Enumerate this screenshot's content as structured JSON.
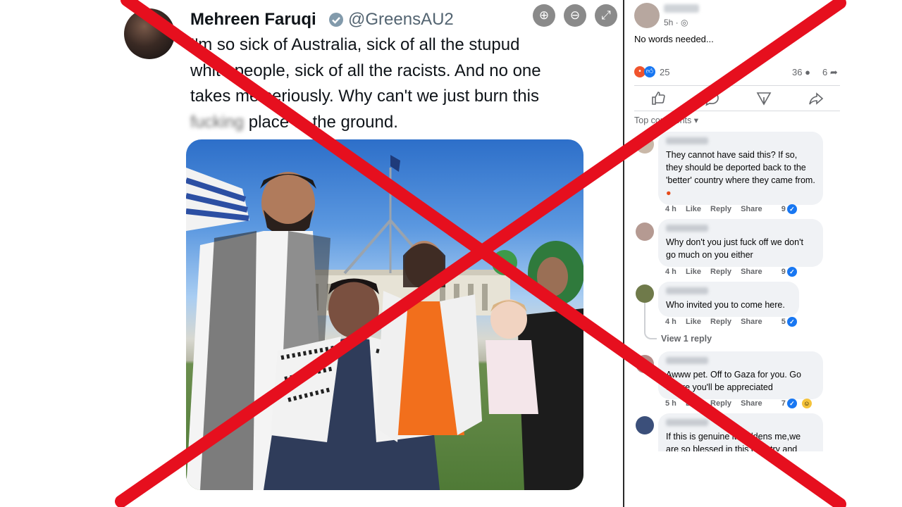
{
  "tweet": {
    "name": "Mehreen Faruqi",
    "handle": "@GreensAU2",
    "text_lines": [
      "I'm so sick of Australia, sick of all the stupud",
      "white people, sick of all the racists. And no one",
      "takes me seriously. Why can't we just burn this"
    ],
    "last_line_censored": "fucking",
    "last_line_rest": "place to the ground.",
    "zoom_controls": [
      "zoom-in-icon",
      "zoom-out-icon",
      "fullscreen-icon"
    ]
  },
  "facebook": {
    "post_time": "5h ·",
    "post_text": "No words needed...",
    "reactions_count": "25",
    "comments_count": "36",
    "shares_count": "6",
    "actions": [
      "like-icon",
      "comment-icon",
      "send-icon",
      "share-icon"
    ],
    "sort_label": "Top comments",
    "view_replies": "View 1 reply",
    "comments": [
      {
        "text": "They cannot have said this? If so, they should be deported back to the 'better' country where they came from.",
        "time": "4 h",
        "like": "Like",
        "reply": "Reply",
        "share": "Share",
        "count": "9"
      },
      {
        "text": "Why don't you just fuck off we don't go much on you either",
        "time": "4 h",
        "like": "Like",
        "reply": "Reply",
        "share": "Share",
        "count": "9"
      },
      {
        "text": "Who invited you to come here.",
        "time": "4 h",
        "like": "Like",
        "reply": "Reply",
        "share": "Share",
        "count": "5"
      },
      {
        "text": "Awww pet. Off to Gaza for you. Go where you'll be appreciated",
        "time": "5 h",
        "like": "Like",
        "reply": "Reply",
        "share": "Share",
        "count": "7"
      },
      {
        "text": "If this is genuine it saddens me,we are so blessed in this country and",
        "time": "",
        "like": "",
        "reply": "",
        "share": "",
        "count": ""
      }
    ]
  },
  "overlay": {
    "mark": "red-x",
    "color": "#e60f1e"
  }
}
